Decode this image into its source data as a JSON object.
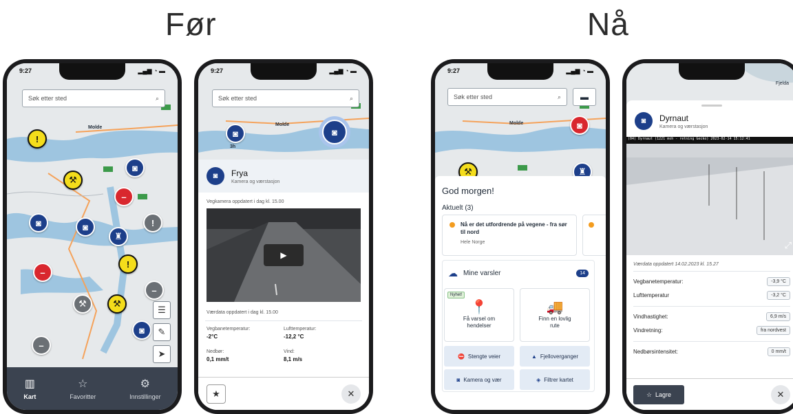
{
  "headings": {
    "before": "Før",
    "now": "Nå"
  },
  "status_time": "9:27",
  "search_placeholder": "Søk etter sted",
  "map_labels": {
    "molde": "Molde",
    "tjeldsund": "Fjelda"
  },
  "phone1": {
    "nav": [
      {
        "label": "Kart",
        "icon": "map-icon"
      },
      {
        "label": "Favoritter",
        "icon": "star-icon"
      },
      {
        "label": "Innstillinger",
        "icon": "gear-icon"
      }
    ]
  },
  "phone2": {
    "title": "Frya",
    "subtitle": "Kamera og værstasjon",
    "camera_updated": "Vegkamera oppdatert i dag kl. 15.00",
    "weather_updated": "Værdata oppdatert i dag kl. 15.00",
    "road_temp_label": "Vegbanetemperatur:",
    "road_temp_value": "-2°C",
    "air_temp_label": "Lufttemperatur:",
    "air_temp_value": "-12,2 °C",
    "precip_label": "Nedbør:",
    "precip_value": "0,1 mm/t",
    "wind_label": "Vind:",
    "wind_value": "8,1 m/s",
    "map_badge": "3h"
  },
  "phone3": {
    "greeting": "God morgen!",
    "news_label": "Aktuelt (3)",
    "news_title": "Nå er det utfordrende på vegene - fra sør til nord",
    "news_area": "Hele Norge",
    "alerts_label": "Mine varsler",
    "alerts_count": "14",
    "new_badge": "Nyhet!",
    "tile1": "Få varsel om hendelser",
    "tile2": "Finn en lovlig rute",
    "btn1": "Stengte veier",
    "btn2": "Fjelloverganger",
    "btn3": "Kamera og vær",
    "btn4": "Filtrer kartet"
  },
  "phone4": {
    "title": "Dyrnaut",
    "subtitle": "Kamera og værstasjon",
    "cam_overlay": "(04) Dyrnaut (1221 moh - retning Gecko) 2023-02-14 15:12:41",
    "updated": "Værdata oppdatert 14.02.2023 kl. 15.27",
    "road_temp_label": "Vegbanetemperatur:",
    "road_temp_value": "-3,9 °C",
    "air_temp_label": "Lufttemperatur",
    "air_temp_value": "-3,2 °C",
    "wind_speed_label": "Vindhastighet:",
    "wind_speed_value": "6,9 m/s",
    "wind_dir_label": "Vindretning:",
    "wind_dir_value": "fra nordvest",
    "precip_label": "Nedbørsintensitet:",
    "precip_value": "0 mm/t",
    "save_label": "Lagre"
  }
}
